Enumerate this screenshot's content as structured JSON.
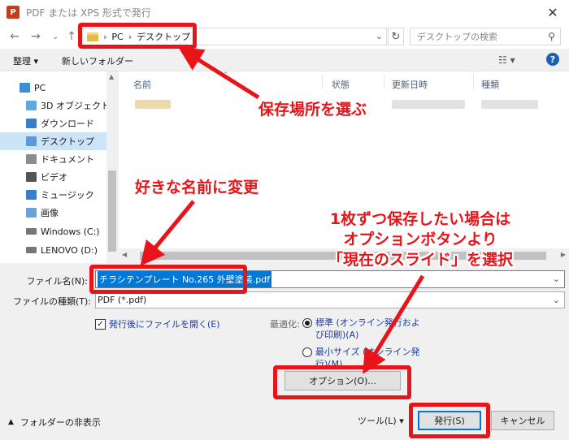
{
  "window": {
    "title": "PDF または XPS 形式で発行",
    "close_glyph": "✕"
  },
  "address_bar": {
    "back": "←",
    "forward": "→",
    "recent": "⌄",
    "up": "↑",
    "crumbs": [
      "PC",
      "デスクトップ"
    ],
    "refresh": "↻",
    "search_placeholder": "デスクトップの検索"
  },
  "toolbar": {
    "organize": "整理 ▾",
    "new_folder": "新しいフォルダー",
    "help": "?"
  },
  "nav": {
    "items": [
      {
        "label": "PC",
        "icon": "pc-icon",
        "color": "#3a8fd9"
      },
      {
        "label": "3D オブジェクト",
        "icon": "3d-objects-icon",
        "color": "#5fa8e0"
      },
      {
        "label": "ダウンロード",
        "icon": "download-icon",
        "color": "#3a7ec9"
      },
      {
        "label": "デスクトップ",
        "icon": "desktop-folder-icon",
        "color": "#5b9bd5",
        "selected": true
      },
      {
        "label": "ドキュメント",
        "icon": "documents-icon",
        "color": "#8c8c8c"
      },
      {
        "label": "ビデオ",
        "icon": "video-icon",
        "color": "#555555"
      },
      {
        "label": "ミュージック",
        "icon": "music-icon",
        "color": "#3a7ec9"
      },
      {
        "label": "画像",
        "icon": "pictures-icon",
        "color": "#6aa3d8"
      },
      {
        "label": "Windows (C:)",
        "icon": "drive-c-icon",
        "color": "#777777"
      },
      {
        "label": "LENOVO (D:)",
        "icon": "drive-d-icon",
        "color": "#777777"
      }
    ]
  },
  "columns": {
    "name": "名前",
    "status": "状態",
    "modified": "更新日時",
    "type": "種類"
  },
  "form": {
    "filename_label": "ファイル名(N):",
    "filename_value": "チラシテンプレート No.265 外壁塗装.pdf",
    "filetype_label": "ファイルの種類(T):",
    "filetype_value": "PDF (*.pdf)",
    "open_after_publish": "発行後にファイルを開く(E)",
    "optimize_label": "最適化:",
    "optimize_standard": [
      "標準 (オンライン発行およ",
      "び印刷)(A)"
    ],
    "optimize_minimum": [
      "最小サイズ (オンライン発",
      "行)(M)"
    ],
    "options_button": "オプション(O)..."
  },
  "footer": {
    "hide_folders": "フォルダーの非表示",
    "tools": "ツール(L)  ▾",
    "publish": "発行(S)",
    "cancel": "キャンセル"
  },
  "annotations": {
    "location": "保存場所を選ぶ",
    "rename": "好きな名前に変更",
    "options_note": [
      "1枚ずつ保存したい場合は",
      "オプションボタンより",
      "「現在のスライド」を選択"
    ]
  },
  "colors": {
    "accent": "#0078d7",
    "annotation_red": "#e7141a",
    "selection": "#cce4f7"
  }
}
